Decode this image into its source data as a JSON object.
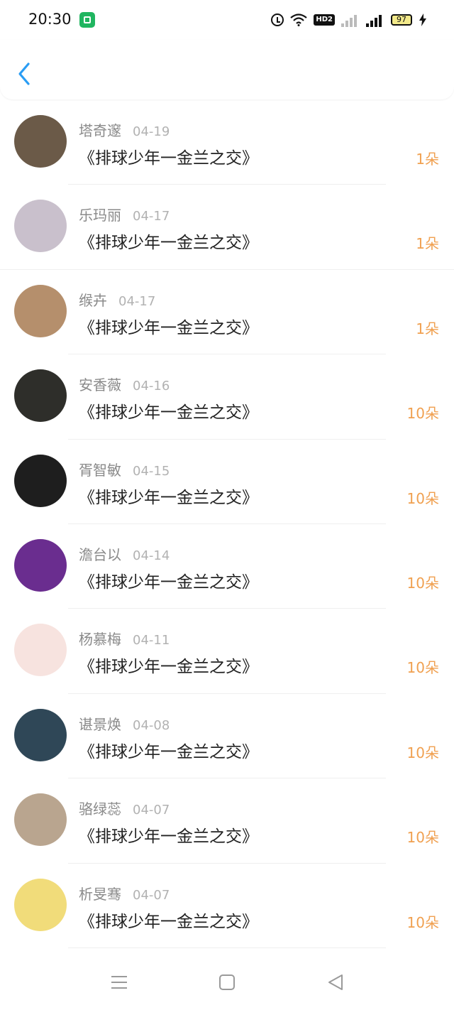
{
  "status": {
    "time": "20:30",
    "battery": "97",
    "hd": "HD2"
  },
  "records": [
    {
      "name": "塔奇邃",
      "date": "04-19",
      "title": "《排球少年一金兰之交》",
      "amount": "1朵",
      "avatar_color": "#6b5a48"
    },
    {
      "name": "乐玛丽",
      "date": "04-17",
      "title": "《排球少年一金兰之交》",
      "amount": "1朵",
      "avatar_color": "#c9c0cc"
    },
    {
      "name": "缑卉",
      "date": "04-17",
      "title": "《排球少年一金兰之交》",
      "amount": "1朵",
      "avatar_color": "#b58f6c"
    },
    {
      "name": "安香薇",
      "date": "04-16",
      "title": "《排球少年一金兰之交》",
      "amount": "10朵",
      "avatar_color": "#2e2e2a"
    },
    {
      "name": "胥智敏",
      "date": "04-15",
      "title": "《排球少年一金兰之交》",
      "amount": "10朵",
      "avatar_color": "#1e1e1e"
    },
    {
      "name": "澹台以",
      "date": "04-14",
      "title": "《排球少年一金兰之交》",
      "amount": "10朵",
      "avatar_color": "#6a2d8f"
    },
    {
      "name": "杨慕梅",
      "date": "04-11",
      "title": "《排球少年一金兰之交》",
      "amount": "10朵",
      "avatar_color": "#f7e3df"
    },
    {
      "name": "谌景焕",
      "date": "04-08",
      "title": "《排球少年一金兰之交》",
      "amount": "10朵",
      "avatar_color": "#2f4757"
    },
    {
      "name": "骆绿蕊",
      "date": "04-07",
      "title": "《排球少年一金兰之交》",
      "amount": "10朵",
      "avatar_color": "#b9a58f"
    },
    {
      "name": "析旻骞",
      "date": "04-07",
      "title": "《排球少年一金兰之交》",
      "amount": "10朵",
      "avatar_color": "#f1dc7a"
    }
  ],
  "icons": {
    "back": "chevron-left-icon",
    "nav_menu": "menu-icon",
    "nav_home": "square-home-icon",
    "nav_back": "triangle-back-icon"
  },
  "colors": {
    "accent": "#2a9df4",
    "amount": "#f0a050"
  }
}
